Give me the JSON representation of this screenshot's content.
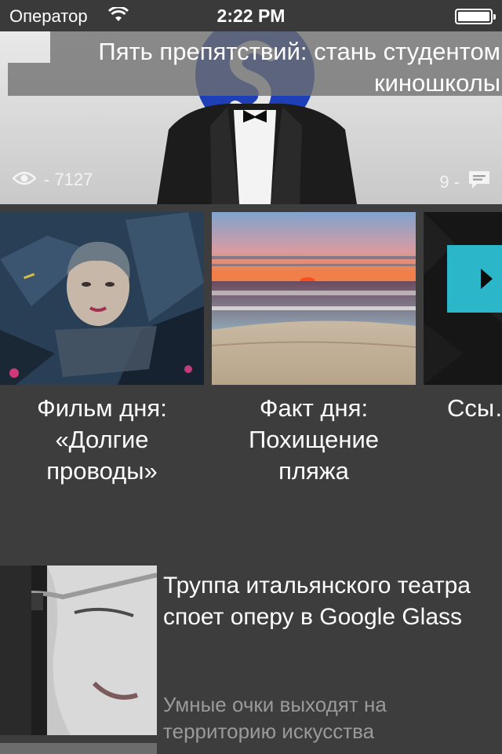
{
  "status_bar": {
    "carrier": "Оператор",
    "time": "2:22 PM"
  },
  "hero": {
    "title": "Пять препятствий: стань студентом киношколы",
    "views": "- 7127",
    "comments": "9 -"
  },
  "cards": [
    {
      "caption": "Фильм дня: «Долгие проводы»"
    },
    {
      "caption": "Факт дня: Похищение пляжа"
    },
    {
      "caption": "Ссы… И… ква…"
    }
  ],
  "article": {
    "title": "Труппа итальянского театра споет оперу в Google Glass",
    "subtitle": "Умные очки выходят на территорию искусства"
  },
  "colors": {
    "background": "#3d3d3d",
    "status_bar": "#3a3a3a",
    "accent_play": "#2bb7c9",
    "subtitle_gray": "#9a9a9a"
  }
}
